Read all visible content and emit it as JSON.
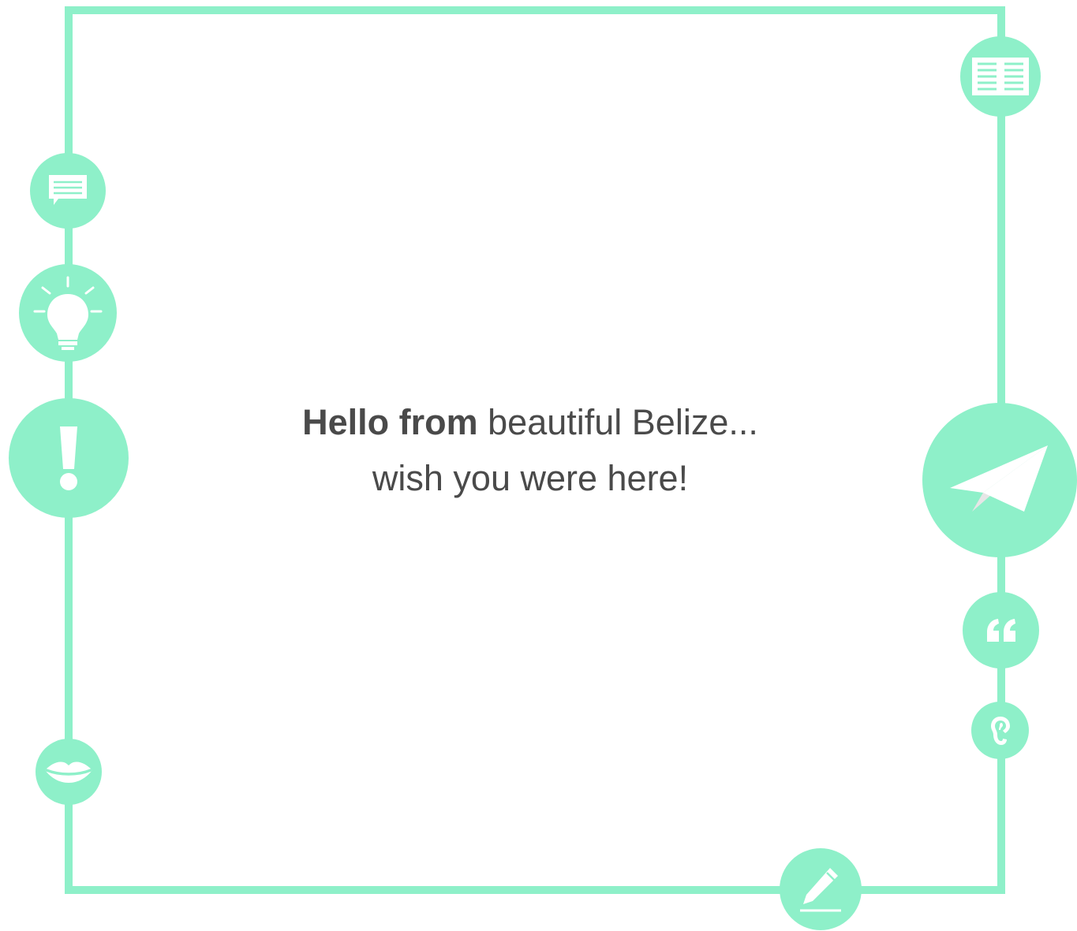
{
  "colors": {
    "accent": "#8ef0c9",
    "text": "#4a4a4a",
    "background": "#ffffff"
  },
  "message": {
    "bold_part": "Hello from",
    "line1_rest": " beautiful Belize...",
    "line2": "wish you were here!"
  },
  "icons": [
    "newspaper-icon",
    "chat-icon",
    "lightbulb-icon",
    "exclamation-icon",
    "paper-plane-icon",
    "quote-icon",
    "ear-icon",
    "lips-icon",
    "pencil-icon"
  ]
}
